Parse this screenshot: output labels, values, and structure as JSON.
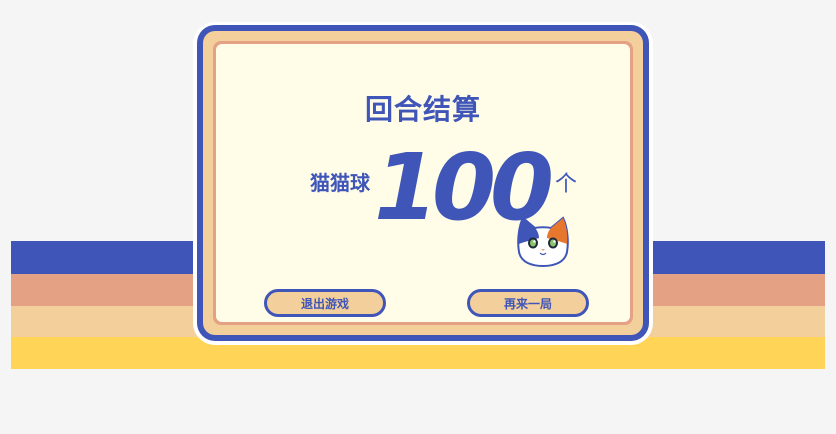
{
  "result_panel": {
    "title": "回合结算",
    "item_label": "猫猫球",
    "count": "100",
    "unit": "个"
  },
  "buttons": {
    "exit_label": "退出游戏",
    "again_label": "再来一局"
  },
  "colors": {
    "blue": "#3f55b8",
    "salmon": "#e4a184",
    "peach": "#f2cf9b",
    "yellow": "#ffd457",
    "cream": "#fffde8"
  }
}
